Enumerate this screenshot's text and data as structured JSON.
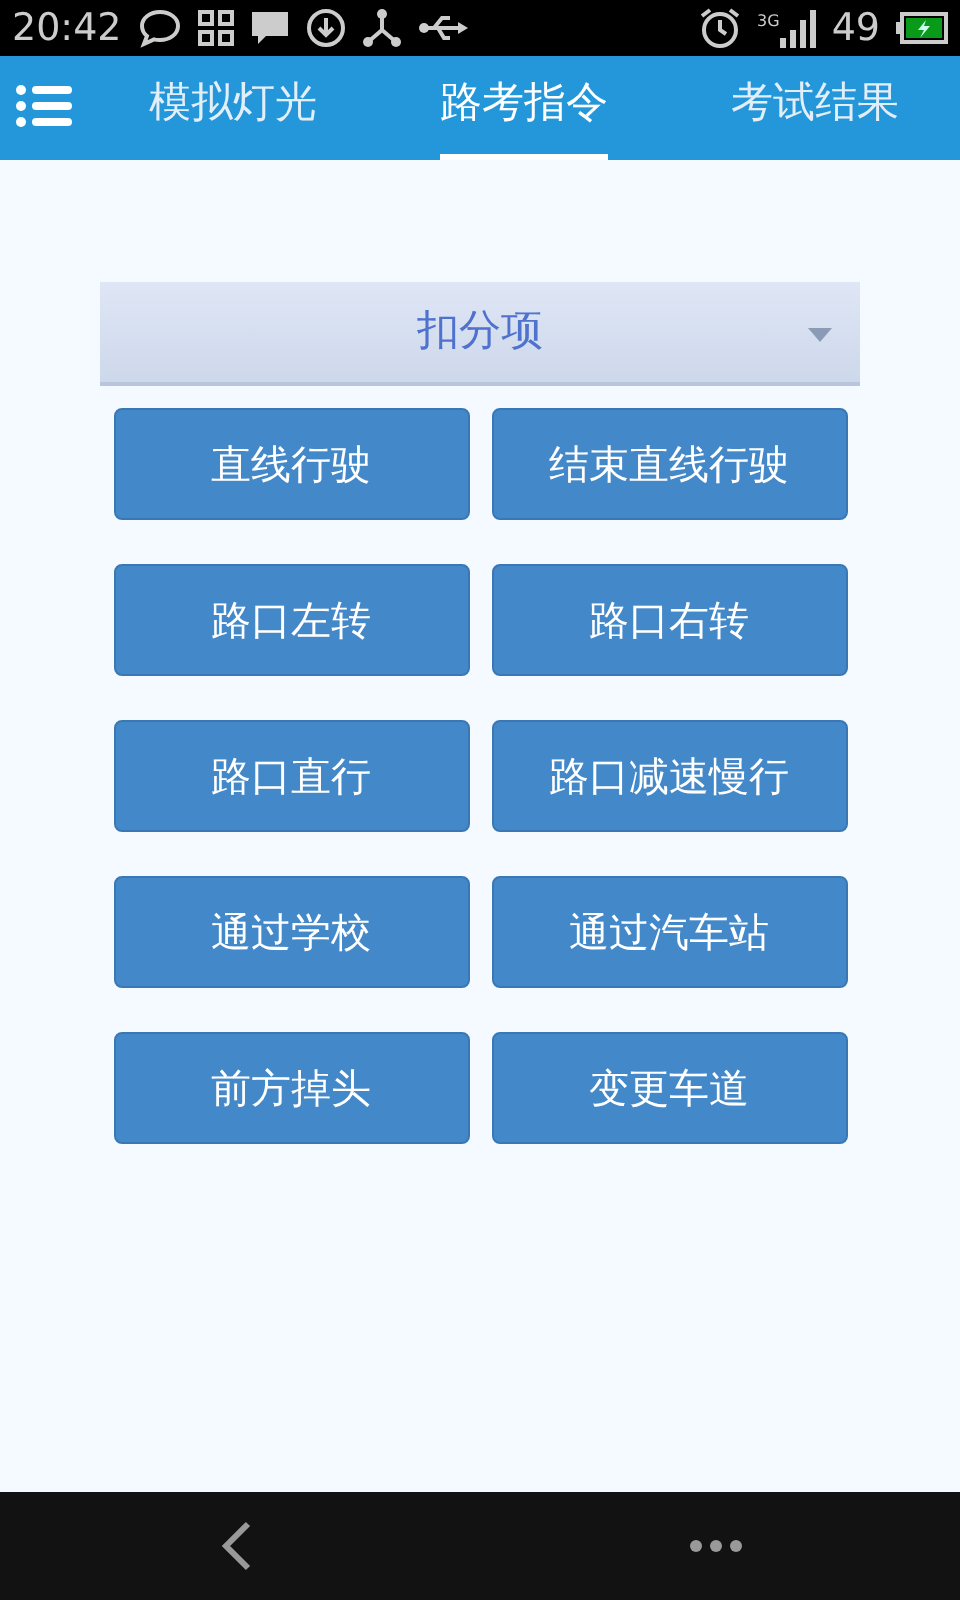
{
  "status_bar": {
    "time": "20:42",
    "network": "3G",
    "battery": "49"
  },
  "tabs": [
    {
      "label": "模拟灯光",
      "selected": false
    },
    {
      "label": "路考指令",
      "selected": true
    },
    {
      "label": "考试结果",
      "selected": false
    }
  ],
  "dropdown": {
    "value": "扣分项"
  },
  "buttons": [
    "直线行驶",
    "结束直线行驶",
    "路口左转",
    "路口右转",
    "路口直行",
    "路口减速慢行",
    "通过学校",
    "通过汽车站",
    "前方掉头",
    "变更车道"
  ]
}
